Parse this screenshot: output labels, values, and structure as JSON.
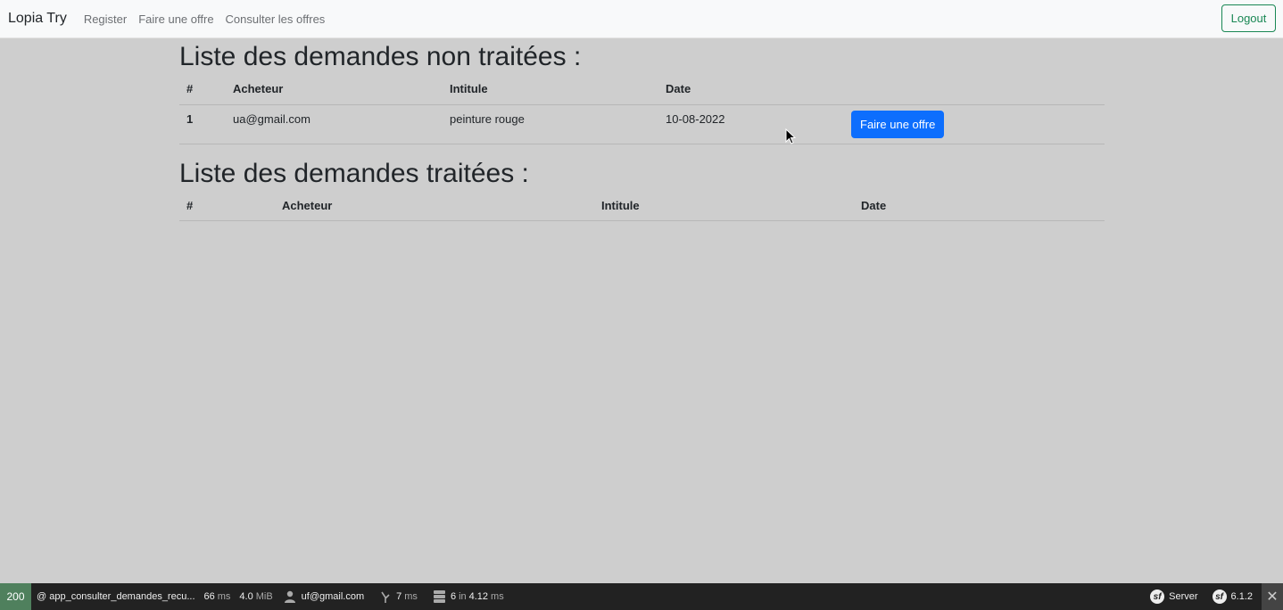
{
  "navbar": {
    "brand": "Lopia Try",
    "links": [
      "Register",
      "Faire une offre",
      "Consulter les offres"
    ],
    "logout_label": "Logout"
  },
  "pending": {
    "title": "Liste des demandes non traitées :",
    "headers": [
      "#",
      "Acheteur",
      "Intitule",
      "Date"
    ],
    "rows": [
      {
        "id": "1",
        "buyer": "ua@gmail.com",
        "title": "peinture rouge",
        "date": "10-08-2022",
        "action": "Faire une offre"
      }
    ]
  },
  "processed": {
    "title": "Liste des demandes traitées :",
    "headers": [
      "#",
      "Acheteur",
      "Intitule",
      "Date"
    ],
    "rows": []
  },
  "debug_toolbar": {
    "status_code": "200",
    "route": "@ app_consulter_demandes_recu...",
    "time_value": "66",
    "time_unit": "ms",
    "memory_value": "4.0",
    "memory_unit": "MiB",
    "user": "uf@gmail.com",
    "twig_value": "7",
    "twig_unit": "ms",
    "db_queries": "6",
    "db_in": "in",
    "db_time": "4.12",
    "db_unit": "ms",
    "server_label": "Server",
    "version": "6.1.2"
  },
  "colors": {
    "primary": "#0d6efd",
    "success": "#198754",
    "status_ok": "#4f805d",
    "background": "#cecece"
  }
}
